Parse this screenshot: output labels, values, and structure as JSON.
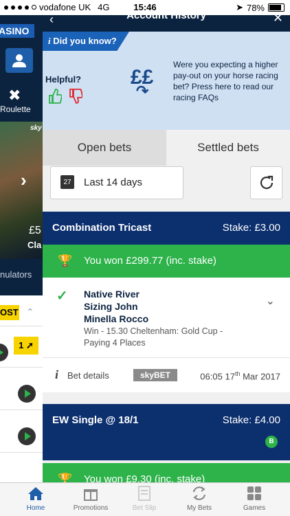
{
  "status_bar": {
    "carrier": "vodafone UK",
    "network": "4G",
    "time": "15:46",
    "battery": "78%"
  },
  "background_app": {
    "brand": "ASINO",
    "roulette_label": "Roulette",
    "promo": {
      "brand": "sky",
      "price_fragment": "£5",
      "text_fragment": "Cla"
    },
    "accumulators_label": "nulators",
    "boost_label": "OST",
    "tag_label": "1"
  },
  "header": {
    "title": "Account History"
  },
  "did_you_know": {
    "tab_label": "Did you know?",
    "helpful_label": "Helpful?",
    "message": "Were you expecting a higher pay-out on your horse racing bet? Press here to read our racing FAQs"
  },
  "tabs": {
    "open": "Open bets",
    "settled": "Settled bets"
  },
  "filter": {
    "calendar_day": "27",
    "range_label": "Last 14 days"
  },
  "bets": [
    {
      "type": "Combination Tricast",
      "stake": "Stake: £3.00",
      "won_text": "You won £299.77 (inc. stake)",
      "runners": [
        "Native River",
        "Sizing John",
        "Minella Rocco"
      ],
      "description": "Win - 15.30 Cheltenham: Gold Cup - Paying 4 Places",
      "bet_details_label": "Bet details",
      "brand_logo": "skyBET",
      "datetime_time": "06:05",
      "datetime_day": "17",
      "datetime_suffix": "th",
      "datetime_rest": "Mar 2017"
    },
    {
      "type": "EW Single @ 18/1",
      "stake": "Stake: £4.00",
      "badge": "B",
      "won_text": "You won £9.30 (inc. stake)"
    }
  ],
  "tab_bar": [
    {
      "label": "Home",
      "icon": "home-icon",
      "state": "active"
    },
    {
      "label": "Promotions",
      "icon": "gift-icon",
      "state": "normal"
    },
    {
      "label": "Bet Slip",
      "icon": "betslip-icon",
      "state": "disabled"
    },
    {
      "label": "My Bets",
      "icon": "mybets-icon",
      "state": "normal"
    },
    {
      "label": "Games",
      "icon": "games-icon",
      "state": "normal"
    }
  ],
  "colors": {
    "navy": "#0c2340",
    "green": "#2db34a",
    "blue": "#1b62b9",
    "yellow": "#f7d400"
  }
}
